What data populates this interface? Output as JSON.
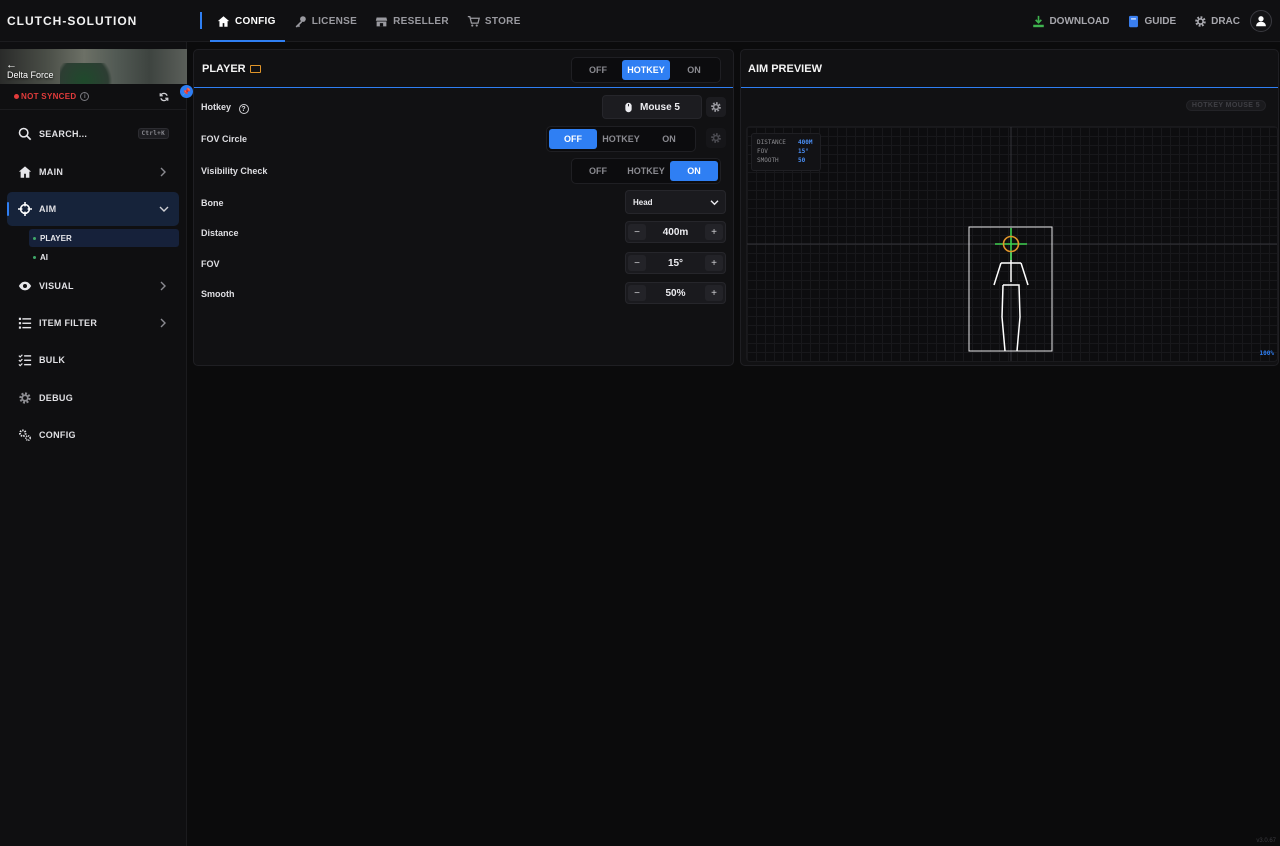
{
  "app": {
    "brand": "CLUTCH-SOLUTION",
    "version": "v3.0.67"
  },
  "topnav": [
    {
      "label": "CONFIG",
      "icon": "home-icon",
      "active": true
    },
    {
      "label": "LICENSE",
      "icon": "key-icon"
    },
    {
      "label": "RESELLER",
      "icon": "store-icon"
    },
    {
      "label": "STORE",
      "icon": "cart-icon"
    }
  ],
  "topright": {
    "download": "DOWNLOAD",
    "guide": "GUIDE",
    "user": "DRAC"
  },
  "sidebar": {
    "game": "Delta Force",
    "sync_status": "NOT SYNCED",
    "search": {
      "label": "SEARCH...",
      "shortcut": "Ctrl+K"
    },
    "items": [
      {
        "label": "MAIN",
        "icon": "home-icon"
      },
      {
        "label": "AIM",
        "icon": "crosshair-icon",
        "active": true
      },
      {
        "label": "VISUAL",
        "icon": "eye-icon"
      },
      {
        "label": "ITEM FILTER",
        "icon": "list-icon"
      },
      {
        "label": "BULK",
        "icon": "checklist-icon"
      },
      {
        "label": "DEBUG",
        "icon": "gear-icon"
      },
      {
        "label": "CONFIG",
        "icon": "gears-icon"
      }
    ],
    "subitems": [
      {
        "label": "PLAYER",
        "active": true
      },
      {
        "label": "AI"
      }
    ]
  },
  "player": {
    "title": "PLAYER",
    "mode": {
      "options": [
        "OFF",
        "HOTKEY",
        "ON"
      ],
      "selected": "HOTKEY"
    },
    "rows": {
      "hotkey": {
        "label": "Hotkey",
        "value": "Mouse 5"
      },
      "fov_circle": {
        "label": "FOV Circle",
        "options": [
          "OFF",
          "HOTKEY",
          "ON"
        ],
        "selected": "OFF"
      },
      "visibility": {
        "label": "Visibility Check",
        "options": [
          "OFF",
          "HOTKEY",
          "ON"
        ],
        "selected": "ON"
      },
      "bone": {
        "label": "Bone",
        "value": "Head"
      },
      "distance": {
        "label": "Distance",
        "value": "400m"
      },
      "fov": {
        "label": "FOV",
        "value": "15°"
      },
      "smooth": {
        "label": "Smooth",
        "value": "50%"
      }
    },
    "stepper": {
      "minus": "−",
      "plus": "+"
    }
  },
  "preview": {
    "title": "AIM PREVIEW",
    "badge": "HOTKEY MOUSE 5",
    "stats": [
      {
        "key": "DISTANCE",
        "value": "400M"
      },
      {
        "key": "FOV",
        "value": "15°"
      },
      {
        "key": "SMOOTH",
        "value": "50"
      }
    ],
    "percent": "100%"
  },
  "colors": {
    "accent": "#2f7ff3",
    "error": "#e23b3b",
    "target": "#3fd050",
    "crosshair": "#e0952a"
  }
}
